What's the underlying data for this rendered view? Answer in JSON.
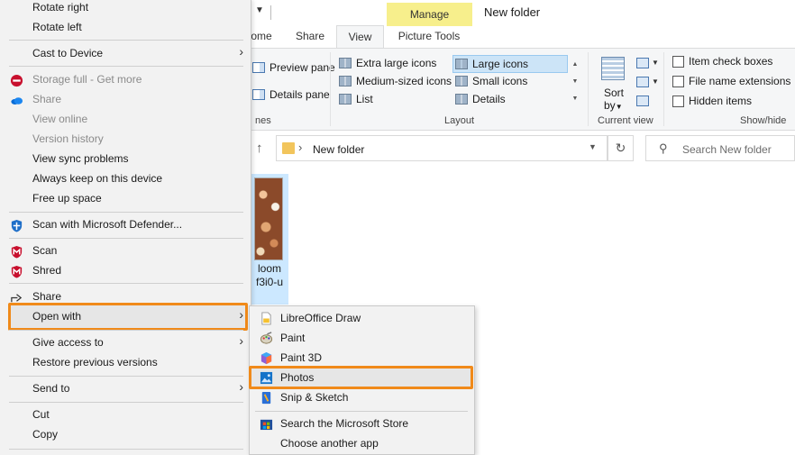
{
  "explorer": {
    "window_title": "New folder",
    "manage_label": "Manage",
    "tabs": [
      {
        "label": "ome"
      },
      {
        "label": "Share"
      },
      {
        "label": "View"
      },
      {
        "label": "Picture Tools"
      }
    ],
    "ribbon": {
      "panes": {
        "preview_pane": "Preview pane",
        "details_pane": "Details pane",
        "group_label": "nes"
      },
      "layout": {
        "extra_large_icons": "Extra large icons",
        "large_icons": "Large icons",
        "medium_icons": "Medium-sized icons",
        "small_icons": "Small icons",
        "list": "List",
        "details": "Details",
        "group_label": "Layout"
      },
      "current_view": {
        "sort_by": "Sort",
        "sort_by_2": "by",
        "group_label": "Current view"
      },
      "show_hide": {
        "item_check_boxes": "Item check boxes",
        "file_name_extensions": "File name extensions",
        "hidden_items": "Hidden items",
        "group_label": "Show/hide"
      }
    },
    "address": {
      "path": "New folder",
      "search_placeholder": "Search New folder"
    },
    "file": {
      "name_line1": "loom",
      "name_line2": "f3i0-u"
    }
  },
  "context_menu": {
    "rotate_right": "Rotate right",
    "rotate_left": "Rotate left",
    "cast_to_device": "Cast to Device",
    "storage_full": "Storage full - Get more",
    "share_onedrive": "Share",
    "view_online": "View online",
    "version_history": "Version history",
    "view_sync_problems": "View sync problems",
    "always_keep": "Always keep on this device",
    "free_up_space": "Free up space",
    "scan_defender": "Scan with Microsoft Defender...",
    "scan": "Scan",
    "shred": "Shred",
    "share": "Share",
    "open_with": "Open with",
    "give_access_to": "Give access to",
    "restore_versions": "Restore previous versions",
    "send_to": "Send to",
    "cut": "Cut",
    "copy": "Copy"
  },
  "open_with_menu": {
    "libreoffice_draw": "LibreOffice Draw",
    "paint": "Paint",
    "paint_3d": "Paint 3D",
    "photos": "Photos",
    "snip_sketch": "Snip & Sketch",
    "search_store": "Search the Microsoft Store",
    "choose_another_app": "Choose another app"
  },
  "colors": {
    "highlight_orange": "#f08a1a",
    "manage_tab_yellow": "#f7ef8c",
    "selection_blue": "#cce8ff"
  }
}
